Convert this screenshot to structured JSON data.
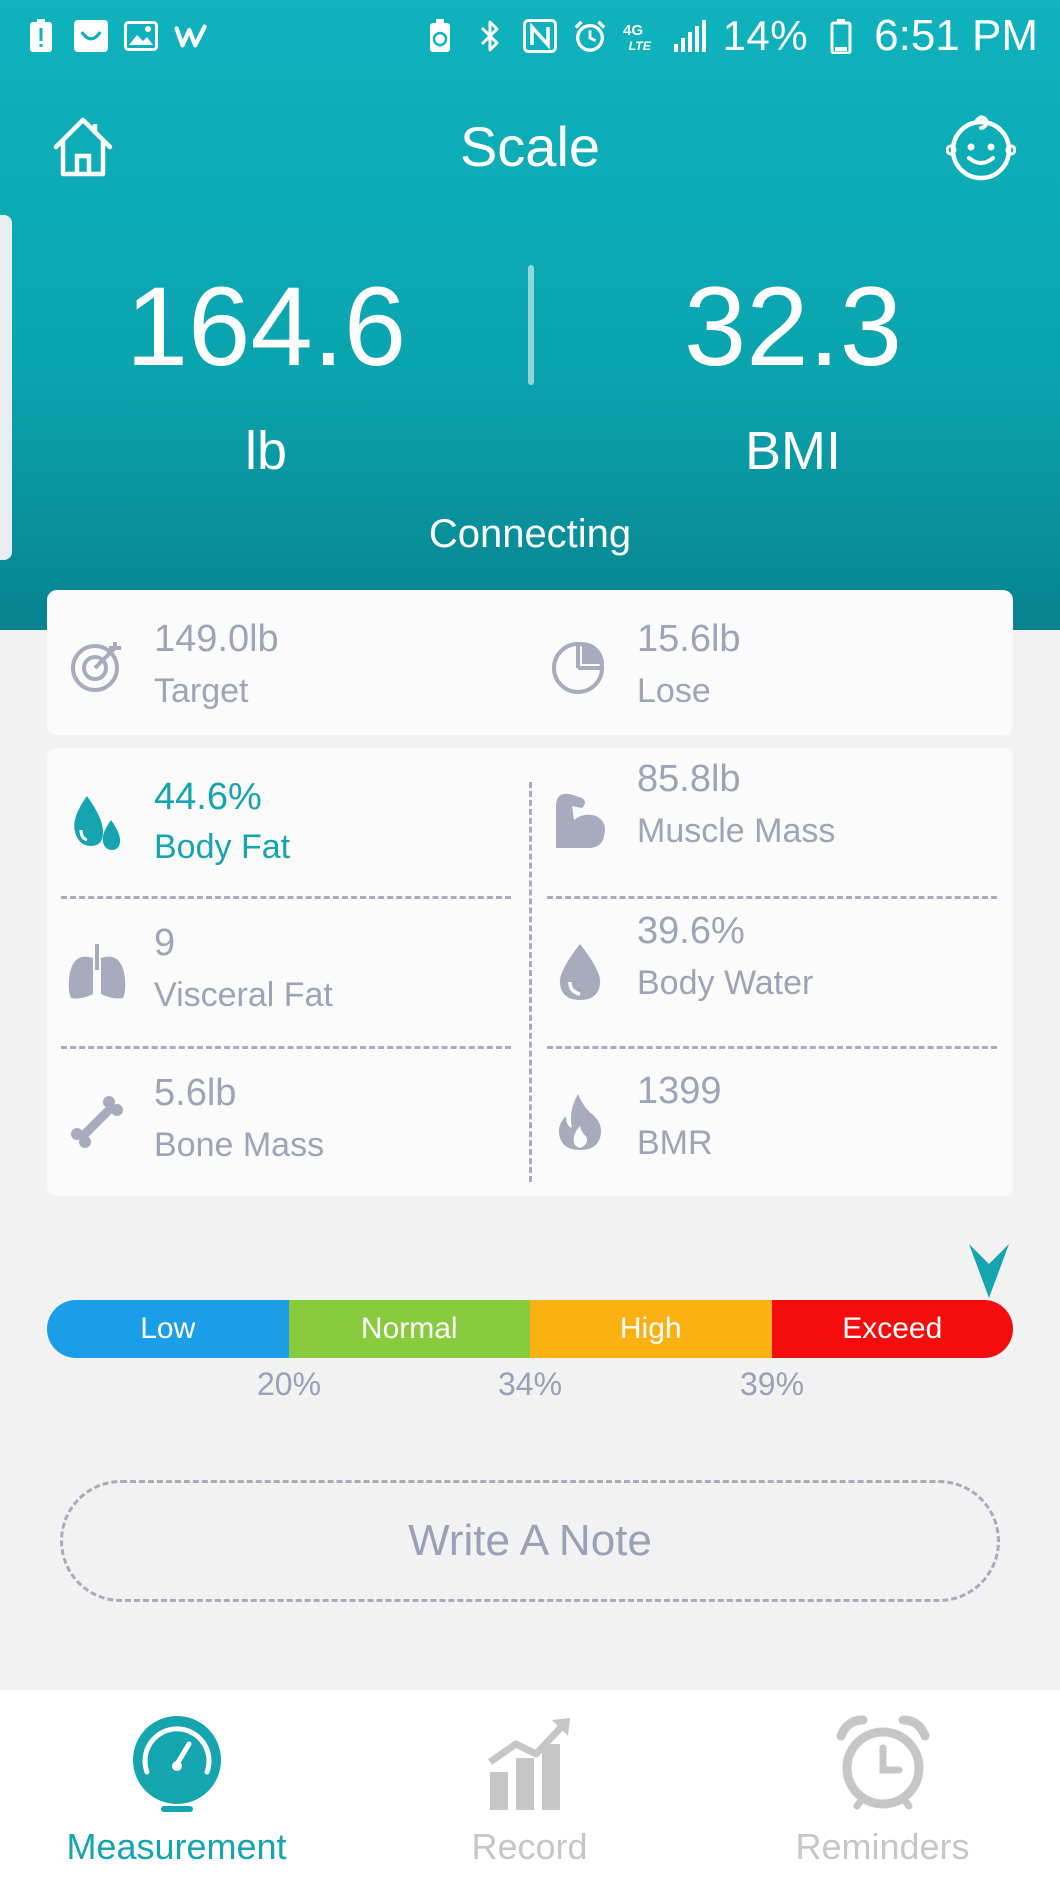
{
  "status_bar": {
    "battery": "14%",
    "time": "6:51 PM",
    "network": "4G"
  },
  "header": {
    "title": "Scale",
    "weight_value": "164.6",
    "weight_unit": "lb",
    "bmi_value": "32.3",
    "bmi_unit": "BMI",
    "connection_status": "Connecting"
  },
  "goal": {
    "target_value": "149.0lb",
    "target_label": "Target",
    "lose_value": "15.6lb",
    "lose_label": "Lose"
  },
  "metrics": [
    {
      "value": "44.6%",
      "label": "Body Fat",
      "icon": "water-drops-icon",
      "highlight": true
    },
    {
      "value": "85.8lb",
      "label": "Muscle Mass",
      "icon": "muscle-arm-icon"
    },
    {
      "value": "9",
      "label": "Visceral Fat",
      "icon": "lungs-icon"
    },
    {
      "value": "39.6%",
      "label": "Body Water",
      "icon": "water-drop-icon"
    },
    {
      "value": "5.6lb",
      "label": "Bone Mass",
      "icon": "bone-icon"
    },
    {
      "value": "1399",
      "label": "BMR",
      "icon": "flame-icon"
    }
  ],
  "range": {
    "segments": [
      {
        "label": "Low",
        "color": "#1b9ee8"
      },
      {
        "label": "Normal",
        "color": "#88cc3d"
      },
      {
        "label": "High",
        "color": "#fcb113"
      },
      {
        "label": "Exceed",
        "color": "#f50d0d"
      }
    ],
    "thresholds": [
      "20%",
      "34%",
      "39%"
    ],
    "indicator_value": "44.6%"
  },
  "note_button": "Write A Note",
  "tabs": [
    {
      "label": "Measurement",
      "icon": "gauge-icon",
      "active": true
    },
    {
      "label": "Record",
      "icon": "bar-chart-icon",
      "active": false
    },
    {
      "label": "Reminders",
      "icon": "alarm-clock-icon",
      "active": false
    }
  ],
  "colors": {
    "accent": "#14a5b0",
    "header": "#0aa3ae",
    "muted": "#9ea3b8"
  }
}
